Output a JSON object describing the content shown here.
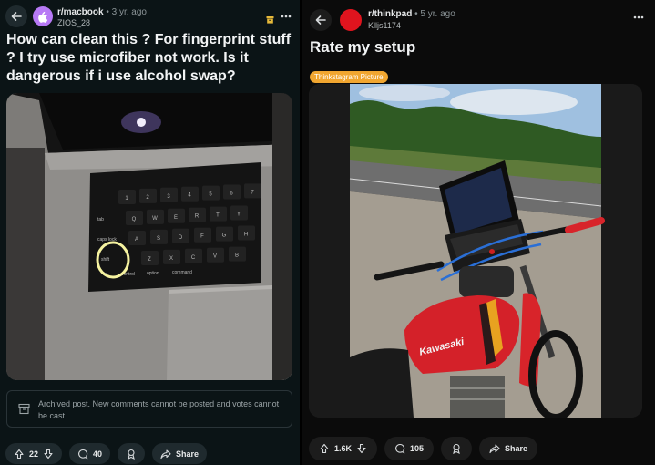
{
  "left_post": {
    "subreddit": "r/macbook",
    "age": " • 3 yr. ago",
    "username": "ZIOS_28",
    "title": "How can clean this ? For fingerprint stuff ? I try use microfiber not work. Is it dangerous if i use alcohol swap?",
    "archived_notice": "Archived post. New comments cannot be posted and votes cannot be cast.",
    "votes": "22",
    "comments": "40",
    "share_label": "Share",
    "avatar_color": "#b779f5"
  },
  "right_post": {
    "subreddit": "r/thinkpad",
    "age": " • 5 yr. ago",
    "username": "Klljs1174",
    "title": "Rate my setup",
    "flair": "Thinkstagram Picture",
    "votes": "1.6K",
    "comments": "105",
    "share_label": "Share",
    "avatar_color": "#e0141e"
  },
  "keyboard_keys": {
    "row1": [
      "1",
      "2",
      "3",
      "4",
      "5",
      "6",
      "7"
    ],
    "row2": [
      "Q",
      "W",
      "E",
      "R",
      "T",
      "Y"
    ],
    "row3": [
      "A",
      "S",
      "D",
      "F",
      "G",
      "H"
    ],
    "row4": [
      "Z",
      "X",
      "C",
      "V",
      "B"
    ],
    "caps": "caps lock",
    "tab": "tab",
    "shift": "shift",
    "fn": "fn",
    "control": "control",
    "option": "option",
    "command": "command"
  },
  "bike_brand": "Kawasaki"
}
